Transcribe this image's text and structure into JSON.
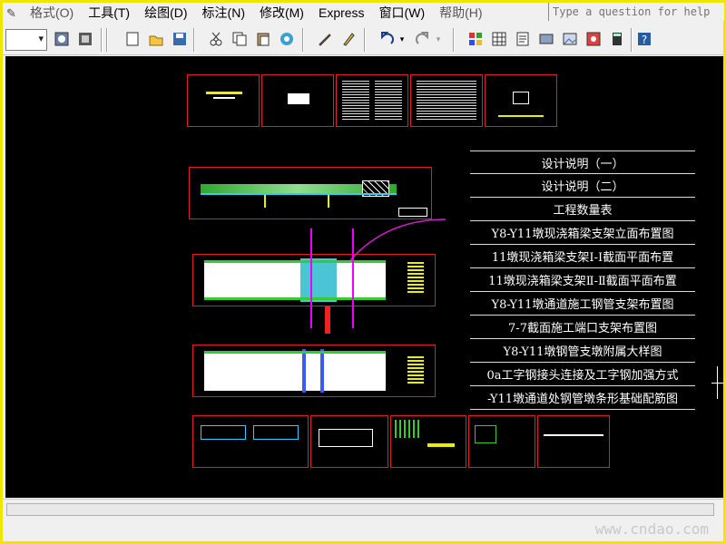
{
  "menubar": {
    "items": [
      "格式(O)",
      "工具(T)",
      "绘图(D)",
      "标注(N)",
      "修改(M)",
      "Express",
      "窗口(W)",
      "帮助(H)"
    ],
    "help_placeholder": "Type a question for help"
  },
  "toolbar": {
    "icons": [
      "combo-box",
      "settings-icon",
      "layers-icon",
      "new-document-icon",
      "open-icon",
      "save-icon",
      "cut-icon",
      "copy-icon",
      "paste-icon",
      "match-icon",
      "pencil-icon",
      "brush-icon",
      "undo-icon",
      "redo-icon",
      "palette-icon",
      "grid-icon",
      "properties-icon",
      "tool-icon",
      "image-icon",
      "calculator-icon",
      "help-icon"
    ]
  },
  "drawing": {
    "legend_items": [
      "设计说明（一）",
      "设计说明（二）",
      "工程数量表",
      "Y8-Y11墩现浇箱梁支架立面布置图",
      "11墩现浇箱梁支架Ⅰ-Ⅰ截面平面布置",
      "11墩现浇箱梁支架Ⅱ-Ⅱ截面平面布置",
      "Y8-Y11墩通道施工钢管支架布置图",
      "7-7截面施工端口支架布置图",
      "Y8-Y11墩钢管支墩附属大样图",
      "0a工字钢接头连接及工字钢加强方式",
      "-Y11墩通道处钢管墩条形基础配筋图"
    ]
  },
  "status": {
    "watermark": "www.cndao.com"
  },
  "colors": {
    "frame": "#f2e600",
    "sheet_border": "#e02020",
    "canvas": "#000000"
  }
}
